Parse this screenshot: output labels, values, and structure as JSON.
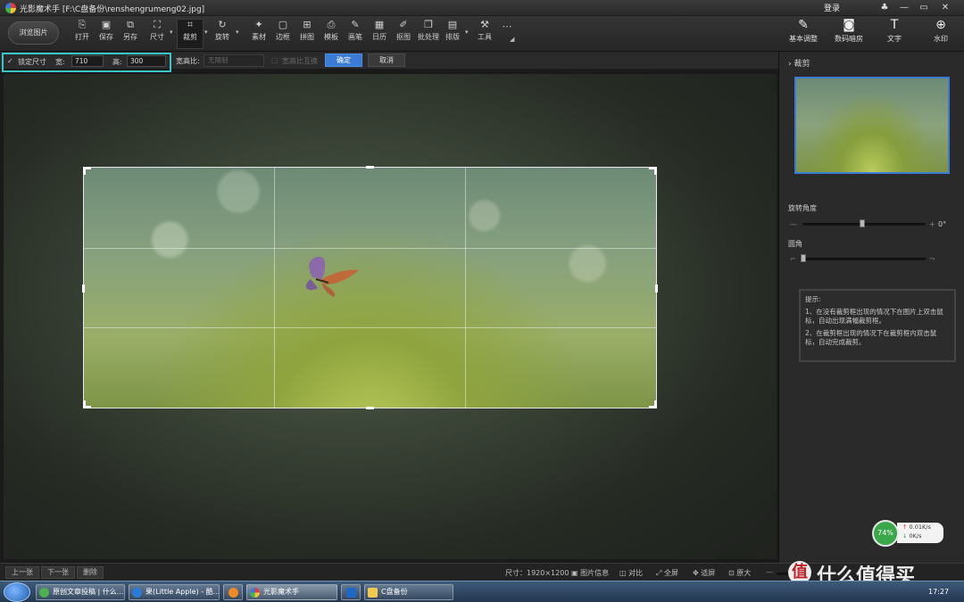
{
  "titlebar": {
    "title": "光影魔术手  [F:\\C盘备份\\renshengrumeng02.jpg]",
    "login": "登录"
  },
  "toolbar": {
    "browse": "浏览图片",
    "tools": [
      "打开",
      "保存",
      "另存",
      "尺寸",
      "裁剪",
      "旋转",
      "素材",
      "边框",
      "拼图",
      "模板",
      "画笔",
      "日历",
      "抠图",
      "批处理",
      "排版",
      "工具"
    ],
    "right_tools": [
      "基本调整",
      "数码暗房",
      "文字",
      "水印"
    ]
  },
  "options": {
    "lock_label": "锁定尺寸",
    "width_label": "宽:",
    "width_value": "710",
    "height_label": "高:",
    "height_value": "300",
    "ratio_label": "宽高比:",
    "ratio_select": "无限制",
    "swap_label": "宽高比互换",
    "ok": "确定",
    "cancel": "取消"
  },
  "panel": {
    "crop_title": "裁剪",
    "rotate_label": "旋转角度",
    "rotate_value": "0°",
    "round_label": "圆角",
    "tips_title": "提示:",
    "tip1": "1、在没有裁剪框出现的情况下在图片上双击鼠标，自动出现满幅裁剪框。",
    "tip2": "2、在裁剪框出现的情况下在裁剪框内双击鼠标，自动完成裁剪。"
  },
  "status": {
    "prev": "上一张",
    "next": "下一张",
    "delete": "删除",
    "size": "尺寸：1920×1200",
    "info": "图片信息",
    "compare": "对比",
    "fullscreen": "全屏",
    "fit": "适屏",
    "zoom": "原大"
  },
  "net": {
    "percent": "74%",
    "up": "0.01K/s",
    "down": "0K/s"
  },
  "taskbar": {
    "items": [
      "原创文章投稿 | 什么...",
      "果(Little Apple) - 酷...",
      "光影魔术手",
      "C盘备份"
    ],
    "clock": "17:27"
  },
  "watermark": "什么值得买",
  "colors": {
    "accent": "#38c6c9",
    "select_blue": "#3a7bd5"
  }
}
